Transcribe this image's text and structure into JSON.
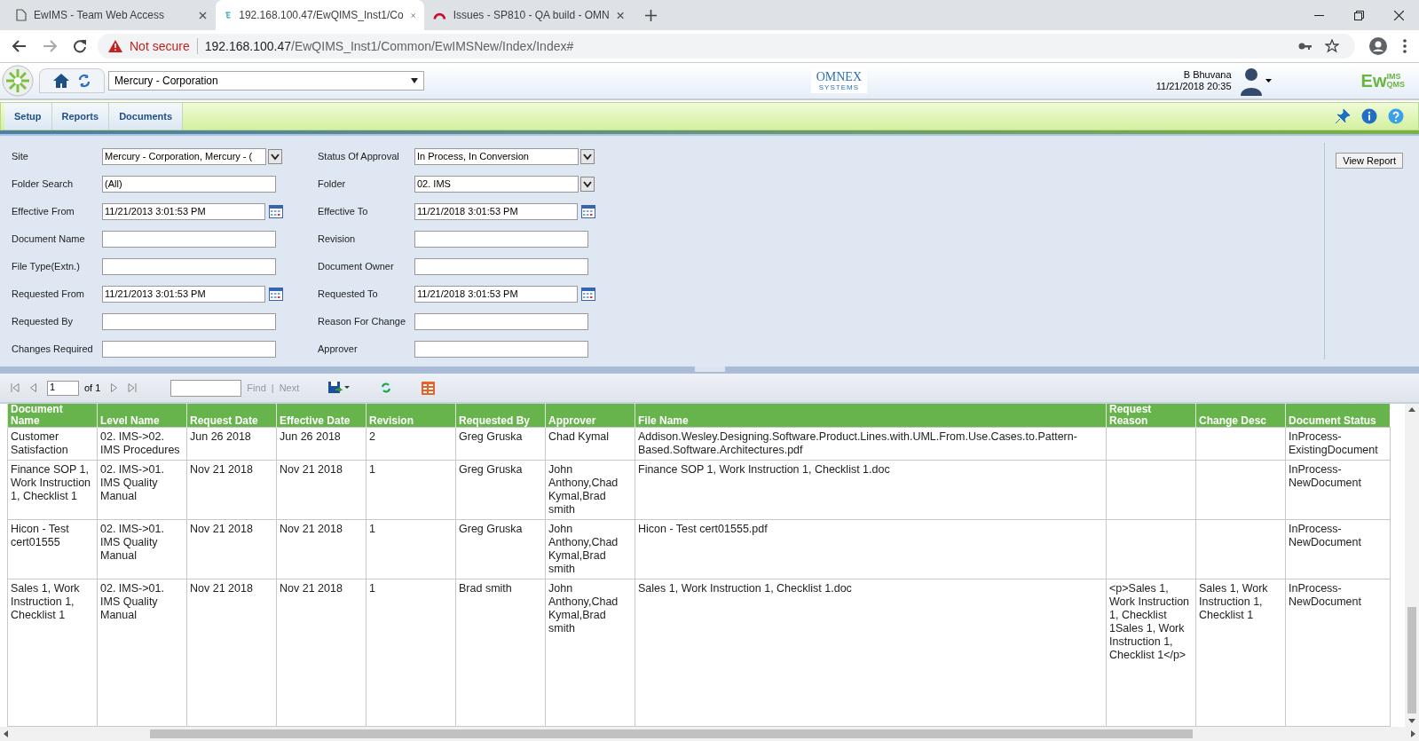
{
  "browser": {
    "tabs": [
      {
        "title": "EwIMS - Team Web Access",
        "selected": false
      },
      {
        "title": "192.168.100.47/EwQIMS_Inst1/Co",
        "selected": true
      },
      {
        "title": "Issues - SP810 - QA build - OMN",
        "selected": false
      }
    ],
    "address": {
      "warning": "Not secure",
      "host": "192.168.100.47",
      "path": "/EwQIMS_Inst1/Common/EwIMSNew/Index/Index#"
    }
  },
  "app": {
    "site": "Mercury - Corporation",
    "company": "OMNEX",
    "company_sub": "SYSTEMS",
    "user": "B Bhuvana",
    "datetime": "11/21/2018 20:35",
    "product": "Ew",
    "product_sup": "IMS",
    "product_sub": "QMS",
    "menu": [
      {
        "label": "Setup"
      },
      {
        "label": "Reports"
      },
      {
        "label": "Documents"
      }
    ]
  },
  "filters": [
    {
      "label": "Site",
      "value": "Mercury - Corporation, Mercury - (",
      "kind": "select"
    },
    {
      "label": "Status Of Approval",
      "value": "In Process, In Conversion",
      "kind": "select"
    },
    {
      "label": "Folder Search",
      "value": "(All)",
      "kind": "text"
    },
    {
      "label": "Folder",
      "value": "02. IMS",
      "kind": "select"
    },
    {
      "label": "Effective From",
      "value": "11/21/2013 3:01:53 PM",
      "kind": "date"
    },
    {
      "label": "Effective To",
      "value": "11/21/2018 3:01:53 PM",
      "kind": "date"
    },
    {
      "label": "Document Name",
      "kind": "text"
    },
    {
      "label": "Revision",
      "kind": "text"
    },
    {
      "label": "File Type(Extn.)",
      "kind": "text"
    },
    {
      "label": "Document Owner",
      "kind": "text"
    },
    {
      "label": "Requested From",
      "value": "11/21/2013 3:01:53 PM",
      "kind": "date"
    },
    {
      "label": "Requested To",
      "value": "11/21/2018 3:01:53 PM",
      "kind": "date"
    },
    {
      "label": "Requested By",
      "kind": "text"
    },
    {
      "label": "Reason For Change",
      "kind": "text"
    },
    {
      "label": "Changes Required",
      "kind": "text"
    },
    {
      "label": "Approver",
      "kind": "text"
    }
  ],
  "view_report": "View Report",
  "toolbar": {
    "page": "1",
    "of": "of 1",
    "find": "Find",
    "separator": "|",
    "next": "Next"
  },
  "table": {
    "columns": [
      "Document Name",
      "Level Name",
      "Request Date",
      "Effective Date",
      "Revision",
      "Requested By",
      "Approver",
      "File Name",
      "Request Reason",
      "Change Desc",
      "Document Status"
    ],
    "rows": [
      [
        "Customer Satisfaction",
        "02. IMS->02. IMS Procedures",
        "Jun 26 2018",
        "Jun 26 2018",
        "2",
        "Greg Gruska",
        "Chad Kymal",
        "Addison.Wesley.Designing.Software.Product.Lines.with.UML.From.Use.Cases.to.Pattern-Based.Software.Architectures.pdf",
        "",
        "",
        "InProcess-ExistingDocument"
      ],
      [
        "Finance SOP 1, Work Instruction 1, Checklist 1",
        "02. IMS->01. IMS Quality Manual",
        "Nov 21 2018",
        "Nov 21 2018",
        "1",
        "Greg Gruska",
        "John Anthony,Chad Kymal,Brad smith",
        "Finance SOP 1, Work Instruction 1, Checklist 1.doc",
        "",
        "",
        "InProcess-NewDocument"
      ],
      [
        "Hicon - Test cert01555",
        "02. IMS->01. IMS Quality Manual",
        "Nov 21 2018",
        "Nov 21 2018",
        "1",
        "Greg Gruska",
        "John Anthony,Chad Kymal,Brad smith",
        "Hicon - Test cert01555.pdf",
        "",
        "",
        "InProcess-NewDocument"
      ],
      [
        "Sales 1, Work Instruction 1, Checklist 1",
        "02. IMS->01. IMS Quality Manual",
        "Nov 21 2018",
        "Nov 21 2018",
        "1",
        "Brad smith",
        "John Anthony,Chad Kymal,Brad smith",
        "Sales 1, Work Instruction 1, Checklist 1.doc",
        "<p>Sales 1, Work Instruction 1, Checklist 1Sales 1, Work Instruction 1, Checklist 1</p>",
        "Sales 1, Work Instruction 1, Checklist 1",
        "InProcess-NewDocument"
      ]
    ]
  }
}
